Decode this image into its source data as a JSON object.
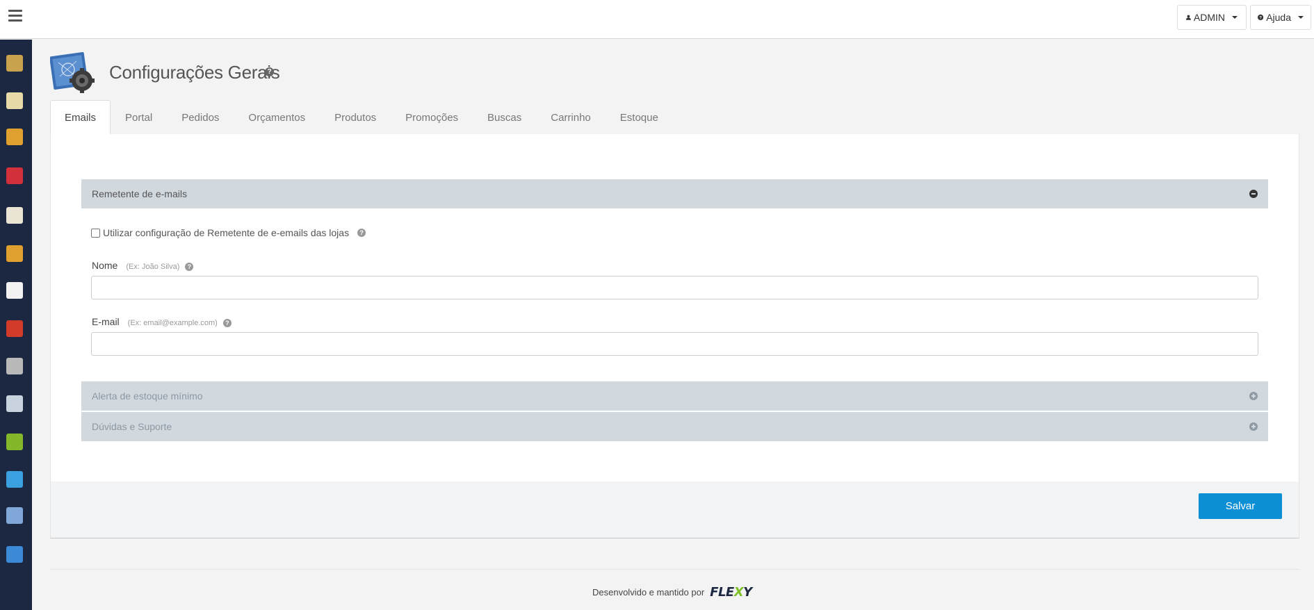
{
  "topbar": {
    "admin_label": "ADMIN",
    "help_label": "Ajuda"
  },
  "sidebar": {
    "items": [
      {
        "icon": "products-box-icon",
        "color": "#c9a24d"
      },
      {
        "icon": "documents-icon",
        "color": "#e8d9a8"
      },
      {
        "icon": "orders-box-icon",
        "color": "#e0a030"
      },
      {
        "icon": "promotions-percent-icon",
        "color": "#d2303a"
      },
      {
        "icon": "card-payment-icon",
        "color": "#e9e4d3"
      },
      {
        "icon": "delivery-truck-icon",
        "color": "#e0a030"
      },
      {
        "icon": "note-paper-icon",
        "color": "#f2f2f2"
      },
      {
        "icon": "customers-people-icon",
        "color": "#d23a2a"
      },
      {
        "icon": "user-person-icon",
        "color": "#b9b9b9"
      },
      {
        "icon": "database-server-icon",
        "color": "#c8d3df"
      },
      {
        "icon": "reports-chart-icon",
        "color": "#84b82a"
      },
      {
        "icon": "share-icon",
        "color": "#3aa0e0"
      },
      {
        "icon": "settings-monitor-icon",
        "color": "#7fa8d8"
      },
      {
        "icon": "help-question-icon",
        "color": "#3a8ad8"
      }
    ]
  },
  "header": {
    "title": "Configurações Gerais",
    "help_glyph": "?"
  },
  "tabs": [
    {
      "label": "Emails",
      "active": true
    },
    {
      "label": "Portal",
      "active": false
    },
    {
      "label": "Pedidos",
      "active": false
    },
    {
      "label": "Orçamentos",
      "active": false
    },
    {
      "label": "Produtos",
      "active": false
    },
    {
      "label": "Promoções",
      "active": false
    },
    {
      "label": "Buscas",
      "active": false
    },
    {
      "label": "Carrinho",
      "active": false
    },
    {
      "label": "Estoque",
      "active": false
    }
  ],
  "sections": {
    "sender": {
      "title": "Remetente de e-mails",
      "use_store_config_label": "Utilizar configuração de Remetente de e-emails das lojas",
      "use_store_config_checked": false,
      "name_label": "Nome",
      "name_hint": "(Ex: João Silva)",
      "name_value": "",
      "email_label": "E-mail",
      "email_hint": "(Ex: email@example.com)",
      "email_value": ""
    },
    "stock_alert": {
      "title": "Alerta de estoque mínimo"
    },
    "support": {
      "title": "Dúvidas e Suporte"
    }
  },
  "actions": {
    "save_label": "Salvar"
  },
  "footer": {
    "text": "Desenvolvido e mantido por",
    "brand_prefix": "FLE",
    "brand_x": "X",
    "brand_suffix": "Y"
  },
  "colors": {
    "sidebar_bg": "#1c2841",
    "accent": "#0d8fd6",
    "accordion_bg": "#d1d8de"
  }
}
